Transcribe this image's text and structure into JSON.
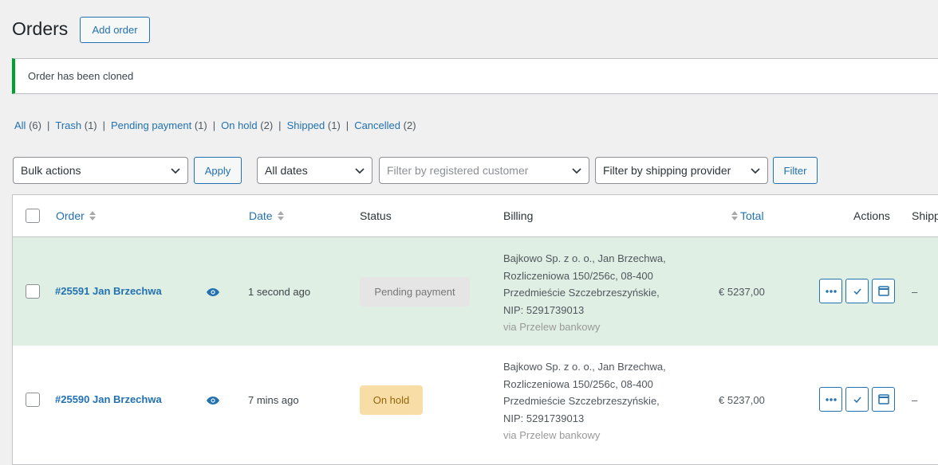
{
  "header": {
    "title": "Orders",
    "add_order_label": "Add order"
  },
  "notice": {
    "text": "Order has been cloned"
  },
  "views": [
    {
      "label": "All",
      "count": "(6)"
    },
    {
      "label": "Trash",
      "count": "(1)"
    },
    {
      "label": "Pending payment",
      "count": "(1)"
    },
    {
      "label": "On hold",
      "count": "(2)"
    },
    {
      "label": "Shipped",
      "count": "(1)"
    },
    {
      "label": "Cancelled",
      "count": "(2)"
    }
  ],
  "filters": {
    "bulk_actions": "Bulk actions",
    "apply_label": "Apply",
    "dates": "All dates",
    "customer_placeholder": "Filter by registered customer",
    "shipping_provider": "Filter by shipping provider",
    "filter_label": "Filter"
  },
  "table": {
    "columns": {
      "order": "Order",
      "date": "Date",
      "status": "Status",
      "billing": "Billing",
      "total": "Total",
      "actions": "Actions",
      "shipping": "Shipp"
    },
    "rows": [
      {
        "order": "#25591 Jan Brzechwa",
        "date": "1 second ago",
        "status": "Pending payment",
        "billing": [
          "Bajkowo Sp. z o. o., Jan Brzechwa,",
          "Rozliczeniowa 150/256c, 08-400",
          "Przedmieście Szczebrzeszyńskie,",
          "NIP: 5291739013"
        ],
        "billing_via": "via Przelew bankowy",
        "total": "€ 5237,00",
        "shipping": "–"
      },
      {
        "order": "#25590 Jan Brzechwa",
        "date": "7 mins ago",
        "status": "On hold",
        "billing": [
          "Bajkowo Sp. z o. o., Jan Brzechwa,",
          "Rozliczeniowa 150/256c, 08-400",
          "Przedmieście Szczebrzeszyńskie,",
          "NIP: 5291739013"
        ],
        "billing_via": "via Przelew bankowy",
        "total": "€ 5237,00",
        "shipping": "–"
      }
    ]
  },
  "colors": {
    "accent": "#2271b1",
    "notice_success": "#00a32a",
    "row_highlight": "#dfefe3",
    "pending_bg": "#e5e5e5",
    "hold_bg": "#f8dda7"
  },
  "icons": [
    "eye-icon",
    "chevron-down-icon",
    "sort-icon",
    "more-icon",
    "check-icon",
    "window-icon"
  ]
}
